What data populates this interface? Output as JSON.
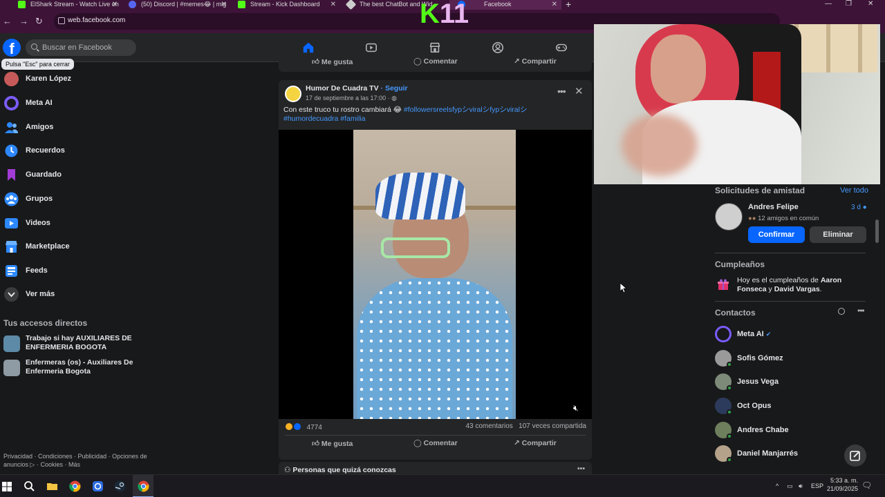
{
  "browser": {
    "tabs": [
      {
        "title": "ElShark Stream - Watch Live on",
        "favicon_color": "#53fc18",
        "active": false
      },
      {
        "title": "(50) Discord | #memes😂 | mig",
        "favicon_color": "#5865f2",
        "active": false
      },
      {
        "title": "Stream - Kick Dashboard",
        "favicon_color": "#53fc18",
        "active": false
      },
      {
        "title": "The best ChatBot and Wid",
        "favicon_color": "#cccccc",
        "active": false
      },
      {
        "title": "Facebook",
        "favicon_color": "#0866ff",
        "active": true
      }
    ],
    "url": "web.facebook.com"
  },
  "stream_overlay": {
    "k": "K",
    "n": "11"
  },
  "header": {
    "logo": "f",
    "search_placeholder": "Buscar en Facebook",
    "tooltip": "Pulsa \"Esc\" para cerrar"
  },
  "sidebar": {
    "items": [
      {
        "label": "Karen López",
        "icon": "profile-avatar",
        "color": "#c65a5a"
      },
      {
        "label": "Meta AI",
        "icon": "meta-ai-icon",
        "color": "#7b5cff"
      },
      {
        "label": "Amigos",
        "icon": "friends-icon",
        "color": "#2d88ff"
      },
      {
        "label": "Recuerdos",
        "icon": "memories-clock-icon",
        "color": "#2d88ff"
      },
      {
        "label": "Guardado",
        "icon": "bookmark-icon",
        "color": "#a33bd6"
      },
      {
        "label": "Grupos",
        "icon": "groups-icon",
        "color": "#2d88ff"
      },
      {
        "label": "Videos",
        "icon": "video-icon",
        "color": "#2d88ff"
      },
      {
        "label": "Marketplace",
        "icon": "marketplace-icon",
        "color": "#2d88ff"
      },
      {
        "label": "Feeds",
        "icon": "feeds-icon",
        "color": "#2d88ff"
      },
      {
        "label": "Ver más",
        "icon": "chevron-down-icon",
        "color": "#3a3b3c"
      }
    ],
    "shortcuts_heading": "Tus accesos directos",
    "shortcuts": [
      {
        "label": "Trabajo si hay AUXILIARES DE ENFERMERIA BOGOTA"
      },
      {
        "label": "Enfermeras (os) - Auxiliares De Enfermeria Bogota"
      }
    ],
    "footer": "Privacidad · Condiciones · Publicidad · Opciones de anuncios ▷ · Cookies · Más"
  },
  "feed": {
    "prev_actions": {
      "like": "Me gusta",
      "comment": "Comentar",
      "share": "Compartir"
    },
    "post": {
      "author": "Humor De Cuadra TV",
      "follow": " · Seguir",
      "date": "17 de septiembre a las 17:00 · ",
      "caption_text": "Con este truco tu rostro cambiará 😂 ",
      "caption_tags": "#followersreelsfypシviralシfypシviralシ #humordecuadra #familia",
      "reaction_count": "4774",
      "comments": "43 comentarios",
      "shares": "107 veces compartida",
      "actions": {
        "like": "Me gusta",
        "comment": "Comentar",
        "share": "Compartir"
      }
    },
    "people_you_may_know": "Personas que quizá conozcas"
  },
  "right_column": {
    "friend_requests": {
      "heading": "Solicitudes de amistad",
      "see_all": "Ver todo",
      "name": "Andres Felipe",
      "time": "3 d",
      "mutual": "12 amigos en común",
      "confirm": "Confirmar",
      "delete": "Eliminar"
    },
    "birthdays": {
      "heading": "Cumpleaños",
      "prefix": "Hoy es el cumpleaños de ",
      "name1": "Aaron Fonseca",
      "joiner": " y ",
      "name2": "David Vargas",
      "suffix": "."
    },
    "contacts": {
      "heading": "Contactos",
      "items": [
        {
          "name": "Meta AI",
          "online": false,
          "verified": true
        },
        {
          "name": "Sofis Gómez",
          "online": true,
          "verified": false
        },
        {
          "name": "Jesus Vega",
          "online": true,
          "verified": false
        },
        {
          "name": "Oct Opus",
          "online": true,
          "verified": false
        },
        {
          "name": "Andres Chabe",
          "online": true,
          "verified": false
        },
        {
          "name": "Daniel Manjarrés",
          "online": true,
          "verified": false
        }
      ]
    }
  },
  "taskbar": {
    "lang": "ESP",
    "time": "5:33 a. m.",
    "date": "21/09/2025"
  },
  "colors": {
    "fb_blue": "#0866ff",
    "link_blue": "#4599ff",
    "bg": "#18191a",
    "card": "#242526",
    "browser_chrome": "#3d1438"
  }
}
